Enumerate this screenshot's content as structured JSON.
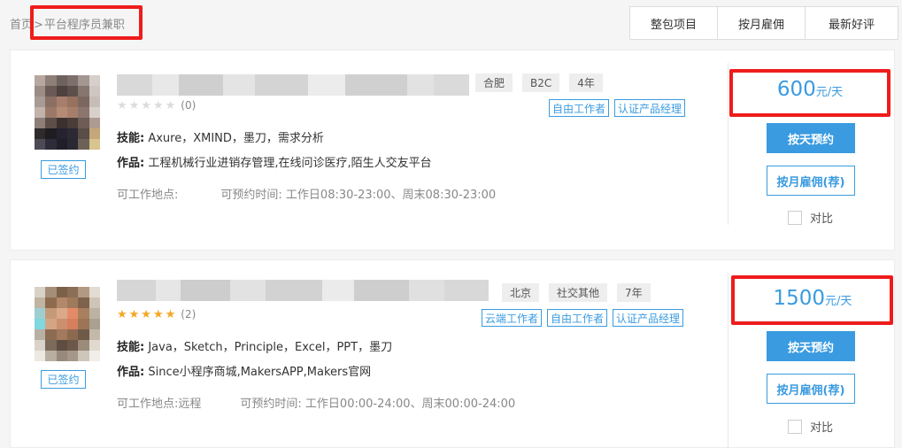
{
  "breadcrumb": {
    "home": "首页",
    "separator": ">",
    "current": "平台程序员兼职"
  },
  "sort_tabs": [
    "整包项目",
    "按月雇佣",
    "最新好评"
  ],
  "cards": [
    {
      "signed_label": "已签约",
      "rating_stars": "★★★★★",
      "rating_count": "(0)",
      "tags": [
        "合肥",
        "B2C",
        "4年"
      ],
      "badges": [
        "自由工作者",
        "认证产品经理"
      ],
      "skills_label": "技能:",
      "skills": " Axure，XMIND，墨刀，需求分析",
      "works_label": "作品:",
      "works": " 工程机械行业进销存管理,在线问诊医疗,陌生人交友平台",
      "location_label": "可工作地点:",
      "location_value": "",
      "availability_label": "可预约时间:",
      "availability_value": "工作日08:30-23:00、周末08:30-23:00",
      "price_value": "600",
      "price_unit": "元/天",
      "book_day_label": "按天预约",
      "hire_month_label": "按月雇佣(荐)",
      "compare_label": "对比"
    },
    {
      "signed_label": "已签约",
      "rating_stars": "★★★★★",
      "rating_count": "(2)",
      "tags": [
        "北京",
        "社交其他",
        "7年"
      ],
      "badges": [
        "云端工作者",
        "自由工作者",
        "认证产品经理"
      ],
      "skills_label": "技能:",
      "skills": " Java，Sketch，Principle，Excel，PPT，墨刀",
      "works_label": "作品:",
      "works": " Since小程序商城,MakersAPP,Makers官网",
      "location_label": "可工作地点:",
      "location_value": "远程",
      "availability_label": "可预约时间:",
      "availability_value": "工作日00:00-24:00、周末00:00-24:00",
      "price_value": "1500",
      "price_unit": "元/天",
      "book_day_label": "按天预约",
      "hire_month_label": "按月雇佣(荐)",
      "compare_label": "对比"
    }
  ],
  "colors": {
    "accent": "#3a9be0",
    "highlight": "#ee1c1c",
    "star": "#f5a623"
  }
}
